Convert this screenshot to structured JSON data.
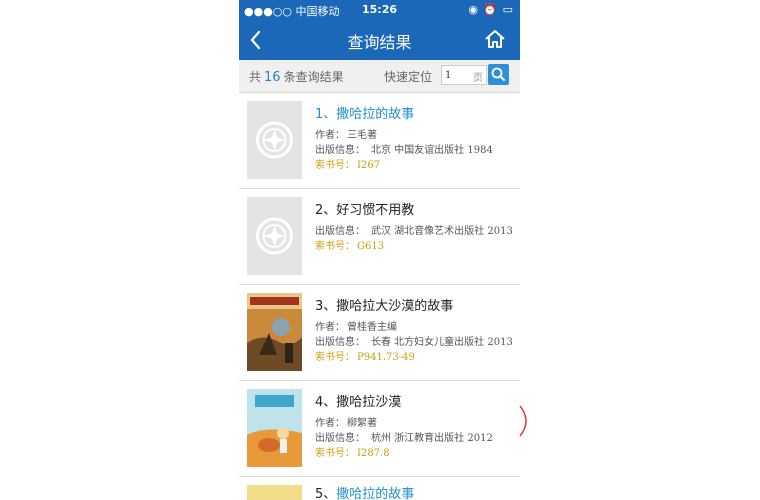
{
  "status_bar": {
    "carrier": "●●●○○ 中国移动",
    "time": "15:26",
    "right_icons": "◉ ⏰ ▭"
  },
  "nav": {
    "title": "查询结果",
    "back_icon": "chevron-left-icon",
    "home_icon": "home-icon"
  },
  "toolbar": {
    "count_prefix": "共",
    "count": "16",
    "count_suffix": "条查询结果",
    "jump_label": "快速定位",
    "page_value": "1",
    "page_unit": "页",
    "search_icon": "search-icon"
  },
  "labels": {
    "author": "作者：",
    "publication": "出版信息：",
    "call_number": "索书号："
  },
  "results": [
    {
      "index": "1、",
      "title": "撒哈拉的故事",
      "author": "三毛著",
      "publication": "北京 中国友谊出版社 1984",
      "call_number": "I267",
      "highlight": true,
      "cover": "placeholder"
    },
    {
      "index": "2、",
      "title": "好习惯不用教",
      "publication": "武汉 湖北音像艺术出版社 2013",
      "call_number": "G613",
      "highlight": false,
      "cover": "placeholder"
    },
    {
      "index": "3、",
      "title": "撒哈拉大沙漠的故事",
      "author": "曾桂香主编",
      "publication": "长春 北方妇女儿童出版社 2013",
      "call_number": "P941.73-49",
      "highlight": false,
      "cover": "illustration"
    },
    {
      "index": "4、",
      "title": "撒哈拉沙漠",
      "author": "柳絮著",
      "publication": "杭州 浙江教育出版社 2012",
      "call_number": "I287.8",
      "highlight": false,
      "cover": "illustration"
    },
    {
      "index": "5、",
      "title": "撒哈拉的故事",
      "highlight": true,
      "cover": "illustration"
    }
  ],
  "colors": {
    "primary": "#1a68b7",
    "link": "#1f8fd0",
    "call_number": "#c9a012",
    "toolbar_bg": "#f0f0f0"
  }
}
